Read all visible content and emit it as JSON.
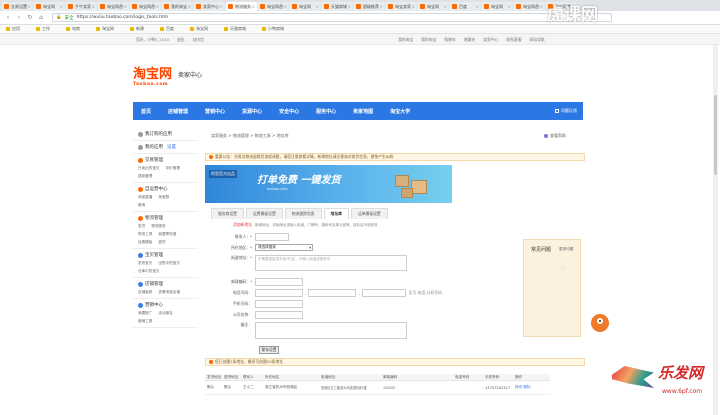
{
  "browser": {
    "tabs": [
      {
        "label": "交易设置",
        "active": false
      },
      {
        "label": "淘宝网",
        "active": false
      },
      {
        "label": "千牛卖家",
        "active": false
      },
      {
        "label": "淘宝网首",
        "active": false
      },
      {
        "label": "淘宝网首",
        "active": false
      },
      {
        "label": "我的淘宝",
        "active": false
      },
      {
        "label": "卖家中心",
        "active": false
      },
      {
        "label": "物流服务",
        "active": true
      },
      {
        "label": "淘宝网首",
        "active": false
      },
      {
        "label": "淘宝网",
        "active": false
      },
      {
        "label": "天猫商城",
        "active": false
      },
      {
        "label": "超级推荐",
        "active": false
      },
      {
        "label": "淘宝卖家",
        "active": false
      },
      {
        "label": "淘宝网",
        "active": false
      },
      {
        "label": "百度",
        "active": false
      },
      {
        "label": "淘宝网",
        "active": false
      },
      {
        "label": "淘宝网首",
        "active": false
      },
      {
        "label": "淘宝网首",
        "active": false
      }
    ],
    "url_secure_label": "安全",
    "url": "https://wuliu.taobao.com/logis_tools.htm",
    "bookmarks": [
      "应用",
      "工作",
      "电商",
      "淘宝网",
      "新建",
      "百度",
      "淘宝网",
      "天猫商城",
      "小鸭商城"
    ]
  },
  "site_nav": {
    "left": [
      "您好，小鸭0_2013",
      "退出",
      "站内信"
    ],
    "right": [
      "我的淘宝",
      "我的淘宝",
      "购物车",
      "收藏夹",
      "卖家中心",
      "联系客服",
      "网站导航"
    ]
  },
  "logo": {
    "brand": "淘宝网",
    "sub": "Taobao.com",
    "title": "卖家中心"
  },
  "main_nav": {
    "items": [
      "首页",
      "店铺管理",
      "营销中心",
      "货源中心",
      "安全中心",
      "服务中心",
      "卖家地图",
      "淘宝大学"
    ],
    "right": "问题反馈"
  },
  "sidebar": {
    "sections": [
      {
        "title": "我订购的应用",
        "rows": [],
        "kind": "gray"
      },
      {
        "title": "我的应用",
        "link": "设置",
        "rows": [],
        "kind": "gray"
      },
      {
        "title": "交易管理",
        "rows": [
          [
            "已卖出的宝贝",
            "评价管理"
          ],
          [
            "退款管理"
          ]
        ],
        "kind": "orange"
      },
      {
        "title": "自运营中心",
        "rows": [
          [
            "淘宝直播",
            "淘宝群"
          ],
          [
            "微淘"
          ]
        ],
        "kind": "orange"
      },
      {
        "title": "物流管理",
        "rows": [
          [
            "发货",
            "物流服务"
          ],
          [
            "物流工具",
            "我要寄快递"
          ],
          [
            "运费模板",
            "退货"
          ]
        ],
        "kind": "orange"
      },
      {
        "title": "宝贝管理",
        "rows": [
          [
            "发布宝贝",
            "出售中的宝贝"
          ],
          [
            "仓库中的宝贝"
          ]
        ],
        "kind": "blue"
      },
      {
        "title": "店铺管理",
        "rows": [
          [
            "店铺装修",
            "查看淘宝店铺"
          ]
        ],
        "kind": "blue"
      },
      {
        "title": "营销中心",
        "rows": [
          [
            "我要推广",
            "活动报名"
          ],
          [
            "营销工具"
          ]
        ],
        "kind": "blue"
      }
    ]
  },
  "crumb": "卖家服务  >  物流管理  >  物流工具  >  地址库",
  "help_center": "查看帮助",
  "notice": "重要公告：交易及物流退换货流程调整，请您注意查看详情，新增地址请注意核对收货信息，避免产生纠纷",
  "banner": {
    "tag": "阿里官方出品",
    "headline": "打单免费  一键发货",
    "sub": "taobao.com"
  },
  "form_tabs": [
    "服务商设置",
    "运费模板设置",
    "物流跟踪信息",
    "地址库",
    "运单模板设置"
  ],
  "form_tabs_active": 3,
  "form": {
    "intro_label": "添加新地址",
    "intro_text": "新增地址。详细地址请输入街道、门牌号、楼栋号及单元室等，保存后不能修改",
    "contact_label": "联系人：",
    "region_label": "所在地区：",
    "region_value": "请选择国家",
    "street_label": "街道地址：",
    "street_placeholder": "不需要重复填写省/市/区，可输入街道或楼栋号",
    "zip_label": "邮政编码：",
    "phone_label": "电话号码：",
    "phone_hint": "区号-电话-分机号码",
    "mobile_label": "手机号码：",
    "company_label": "公司名称：",
    "remark_label": "备注：",
    "save_label": "保存设置"
  },
  "notice2": "您已创建2条地址，最多可创建20条地址",
  "table": {
    "headers": [
      "发货地址",
      "退货地址",
      "联系人",
      "所在地区",
      "街道地址",
      "邮政编码",
      "电话号码",
      "手机号码",
      "操作"
    ],
    "row": [
      "默认",
      "默认",
      "王小二",
      "浙江省杭州市西湖区",
      "西湖区文三路浙大科技园B座5楼",
      "310000",
      "",
      "13757202317",
      "修改 删除"
    ]
  },
  "faq": {
    "title": "常见问题",
    "more": "更多问题"
  },
  "watermark_top": "虎课网",
  "watermark_bottom": {
    "title": "乐发网",
    "url": "www.6pf.com"
  }
}
